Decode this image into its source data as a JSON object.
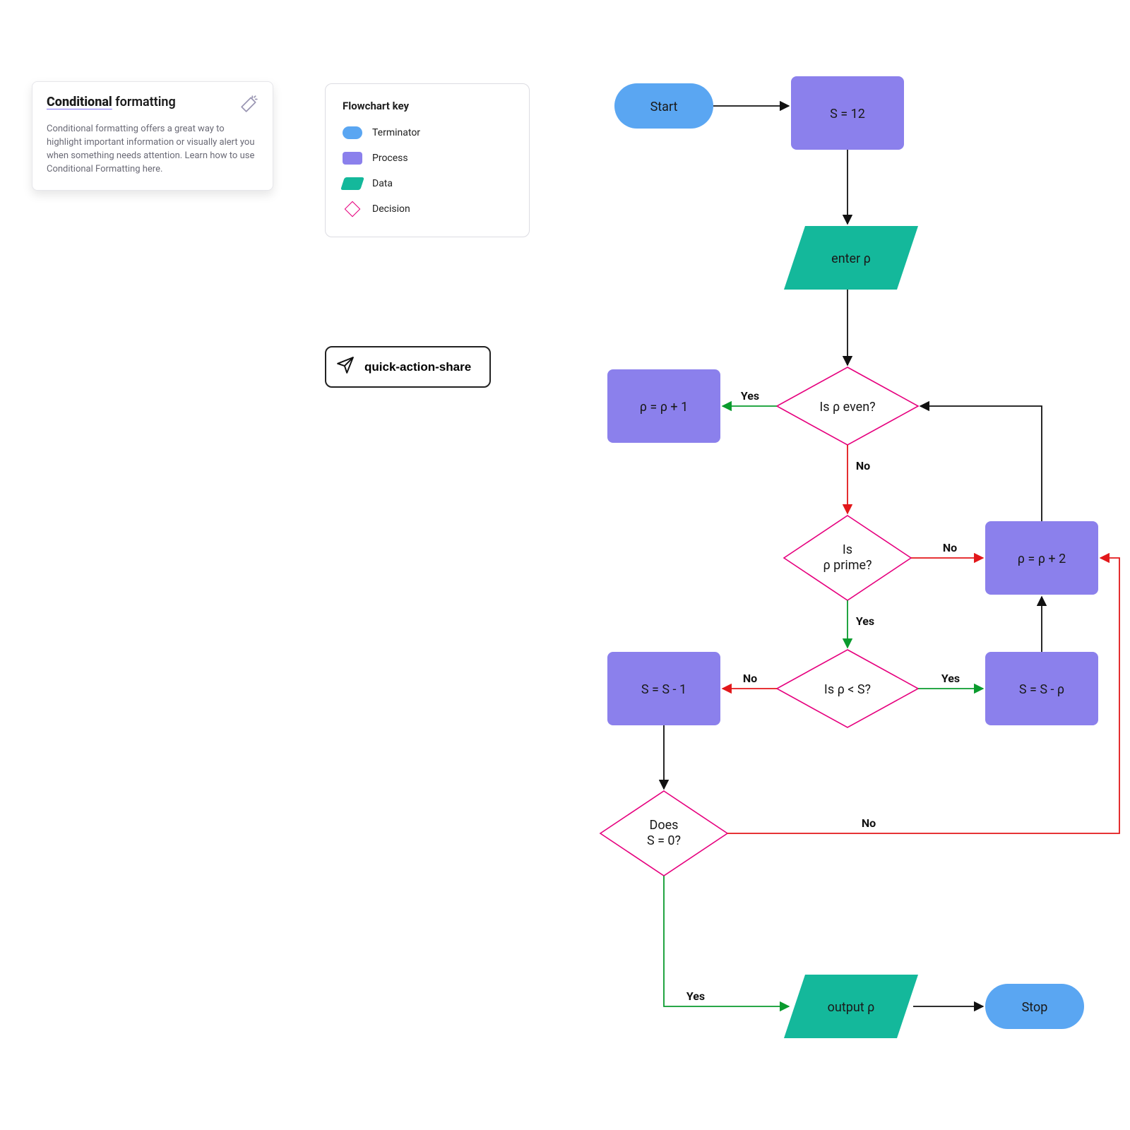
{
  "info_card": {
    "title_highlight": "Conditional",
    "title_rest": " formatting",
    "body": "Conditional formatting offers a great way to highlight important information or visually alert you when something needs attention. Learn how to use Conditional Formatting here."
  },
  "legend": {
    "title": "Flowchart key",
    "terminator": "Terminator",
    "process": "Process",
    "data": "Data",
    "decision": "Decision"
  },
  "quick_share_label": "quick-action-share",
  "nodes": {
    "start": "Start",
    "s_init": "S = 12",
    "enter_rho": "enter ρ",
    "is_even": "Is ρ even?",
    "rho_plus1": "ρ = ρ + 1",
    "is_prime_line1": "Is",
    "is_prime_line2": "ρ prime?",
    "rho_plus2": "ρ = ρ + 2",
    "is_lt_s": "Is ρ < S?",
    "s_sub_rho": "S = S - ρ",
    "s_sub_1": "S = S - 1",
    "does_s0_line1": "Does",
    "does_s0_line2": "S = 0?",
    "output_rho": "output ρ",
    "stop": "Stop"
  },
  "edge_labels": {
    "yes": "Yes",
    "no": "No"
  },
  "colors": {
    "terminator": "#5aa6f2",
    "process": "#8b80ec",
    "data": "#14b89b",
    "decision_border": "#e6007e",
    "arrow_black": "#111111",
    "arrow_green": "#0a9b2e",
    "arrow_red": "#e2171a"
  }
}
